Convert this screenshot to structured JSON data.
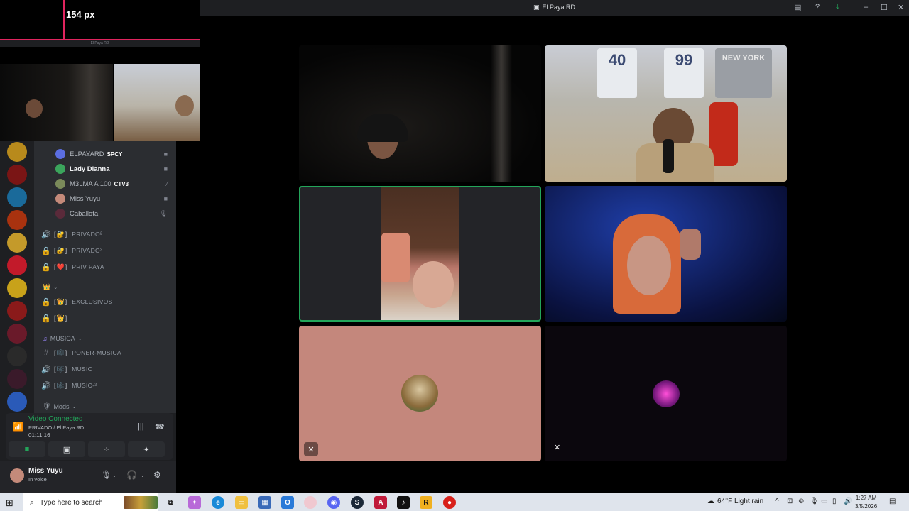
{
  "window": {
    "title": "El Paya RD"
  },
  "popout": {
    "pixel_readout": "154 px",
    "bar_label": "El Paya RD"
  },
  "servers": [
    {
      "icon": "star-server-icon",
      "color": "#b88a1c"
    },
    {
      "icon": "red-server-icon",
      "color": "#7a1515"
    },
    {
      "icon": "blue-server-icon",
      "color": "#1a6a9a"
    },
    {
      "icon": "fire-server-icon",
      "color": "#a8320f"
    },
    {
      "icon": "onlyplay-server-icon",
      "color": "#c49a2a"
    },
    {
      "icon": "only-server-icon",
      "color": "#c21a2a"
    },
    {
      "icon": "latino-server-icon",
      "color": "#c8a21a"
    },
    {
      "icon": "eterna-server-icon",
      "color": "#8a1a1a"
    },
    {
      "icon": "rol-server-icon",
      "color": "#6a1a2a"
    },
    {
      "icon": "dark-server-icon",
      "color": "#2a2a2a"
    },
    {
      "icon": "dim-server-icon",
      "color": "#3a1a2a"
    },
    {
      "icon": "avatar-server-icon",
      "color": "#2a5ab8"
    }
  ],
  "voice_users": [
    {
      "name": "ELPAYARD",
      "tag": "SPCY",
      "color": "#5b6ee1",
      "status_icon": "camera-icon"
    },
    {
      "name": "Lady Dianna",
      "tag": "",
      "color": "#3ba55c",
      "status_icon": "camera-icon"
    },
    {
      "name": "M3LMA A 100",
      "tag": "CTV3",
      "color": "#7a8a5a",
      "status_icon": "deafened-icon"
    },
    {
      "name": "Miss Yuyu",
      "tag": "",
      "color": "#c48a7a",
      "status_icon": "camera-icon"
    },
    {
      "name": "Caballota",
      "tag": "",
      "color": "#5a2a3a",
      "status_icon": "muted-icon"
    }
  ],
  "channels": [
    {
      "label": "privado²",
      "icon": "speaker-icon",
      "badge": "🔐"
    },
    {
      "label": "privado³",
      "icon": "lock-icon",
      "badge": "🔐"
    },
    {
      "label": "priv paya",
      "icon": "lock-icon",
      "badge": "❤️"
    }
  ],
  "category_crown": "👑",
  "channels_crown": [
    {
      "label": "exclusivos",
      "icon": "lock-icon",
      "badge": "👑"
    },
    {
      "label": "",
      "icon": "lock-icon",
      "badge": "👑"
    }
  ],
  "category_musica": "MUSICA",
  "channels_music": [
    {
      "label": "poner-musica",
      "icon": "hash-icon",
      "badge": "🎼"
    },
    {
      "label": "music",
      "icon": "speaker-icon",
      "badge": "🎼"
    },
    {
      "label": "music-²",
      "icon": "speaker-icon",
      "badge": "🎼"
    }
  ],
  "category_mods": "Mods",
  "voice_panel": {
    "status": "Video Connected",
    "location": "PRIVADO / El Paya RD",
    "elapsed": "01:11:16"
  },
  "user_panel": {
    "name": "Miss Yuyu",
    "status": "In voice"
  },
  "tiles": {
    "t2_jerseys": [
      "40",
      "99",
      "NEW YORK"
    ]
  },
  "taskbar": {
    "search_placeholder": "Type here to search",
    "weather": "64°F  Light rain",
    "time": "1:27 AM",
    "date": "3/5/2026"
  }
}
